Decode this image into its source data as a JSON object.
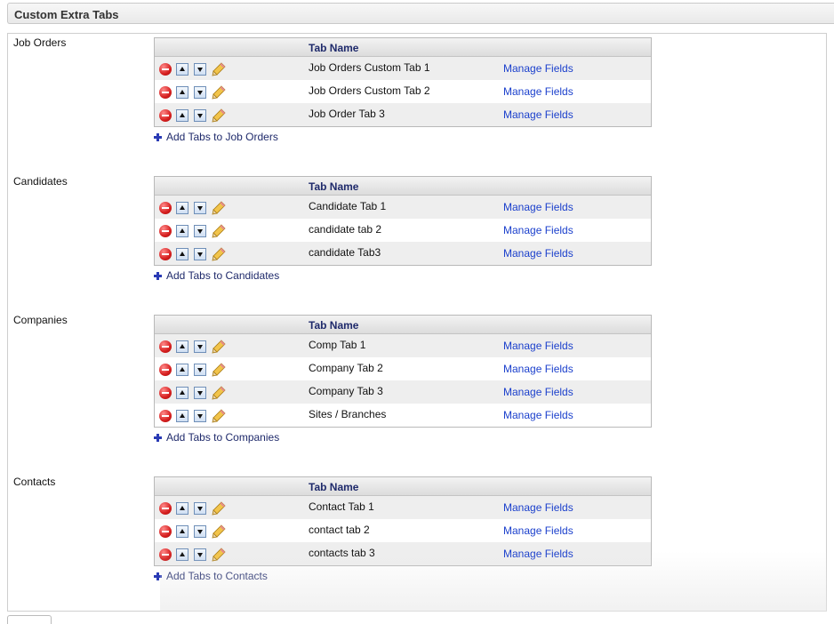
{
  "page": {
    "title": "Custom Extra Tabs"
  },
  "labels": {
    "tab_name_header": "Tab Name",
    "manage_fields": "Manage Fields"
  },
  "sections": [
    {
      "label": "Job Orders",
      "add_label": "Add Tabs to Job Orders",
      "tabs": [
        "Job Orders Custom Tab 1",
        "Job Orders Custom Tab 2",
        "Job Order Tab 3"
      ]
    },
    {
      "label": "Candidates",
      "add_label": "Add Tabs to Candidates",
      "tabs": [
        "Candidate Tab 1",
        "candidate tab 2",
        "candidate Tab3"
      ]
    },
    {
      "label": "Companies",
      "add_label": "Add Tabs to Companies",
      "tabs": [
        "Comp Tab 1",
        "Company Tab 2",
        "Company Tab 3",
        "Sites / Branches"
      ]
    },
    {
      "label": "Contacts",
      "add_label": "Add Tabs to Contacts",
      "tabs": [
        "Contact Tab 1",
        "contact tab 2",
        "contacts tab 3"
      ]
    }
  ],
  "icons": {
    "delete": "delete-icon",
    "move_up": "arrow-up-icon",
    "move_down": "arrow-down-icon",
    "edit": "pencil-icon",
    "add": "plus-icon"
  },
  "colors": {
    "link": "#1a3fcc",
    "header_text": "#1f2a6b",
    "row_shade": "#eeeeee",
    "delete_red": "#d61f1f"
  }
}
